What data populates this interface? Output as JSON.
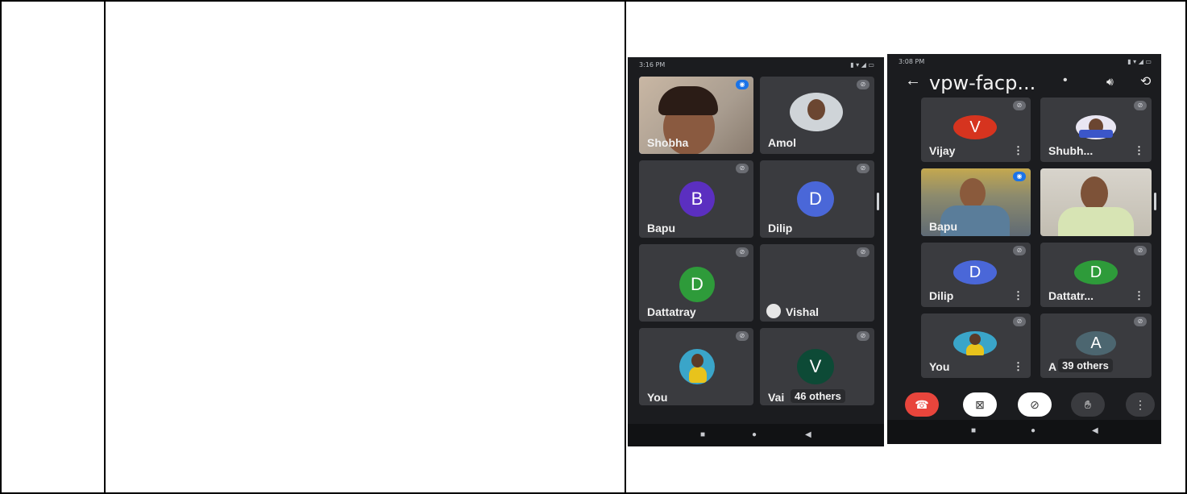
{
  "left_phone": {
    "status_time": "3:16 PM",
    "status_icons": "▮ ▾ ◢ ▭",
    "tiles": [
      {
        "name": "Shobha"
      },
      {
        "name": "Amol"
      },
      {
        "name": "Bapu",
        "initial": "B"
      },
      {
        "name": "Dilip",
        "initial": "D"
      },
      {
        "name": "Dattatray",
        "initial": "D"
      },
      {
        "name": "Vishal"
      },
      {
        "name": "You"
      },
      {
        "name": "Vai",
        "initial": "V",
        "others": "46 others"
      }
    ]
  },
  "right_phone": {
    "status_time": "3:08 PM",
    "status_icons": "▮ ▾ ◢ ▭",
    "meeting_title": "vpw-facp...",
    "tiles": [
      {
        "name": "Vijay",
        "initial": "V"
      },
      {
        "name": "Shubh..."
      },
      {
        "name": "Bapu"
      },
      {
        "name": ""
      },
      {
        "name": "Dilip",
        "initial": "D"
      },
      {
        "name": "Dattatr...",
        "initial": "D"
      },
      {
        "name": "You"
      },
      {
        "name": "A",
        "initial": "A",
        "others": "39 others"
      }
    ]
  },
  "colors": {
    "purple_avatar": "#5b2fc0",
    "blue_avatar": "#4a67d8",
    "green_avatar": "#2e9b3a",
    "dark_teal_avatar": "#0d4a36",
    "red_avatar": "#d6341f",
    "slate_avatar": "#4c6670",
    "end_call_red": "#e8453c"
  }
}
